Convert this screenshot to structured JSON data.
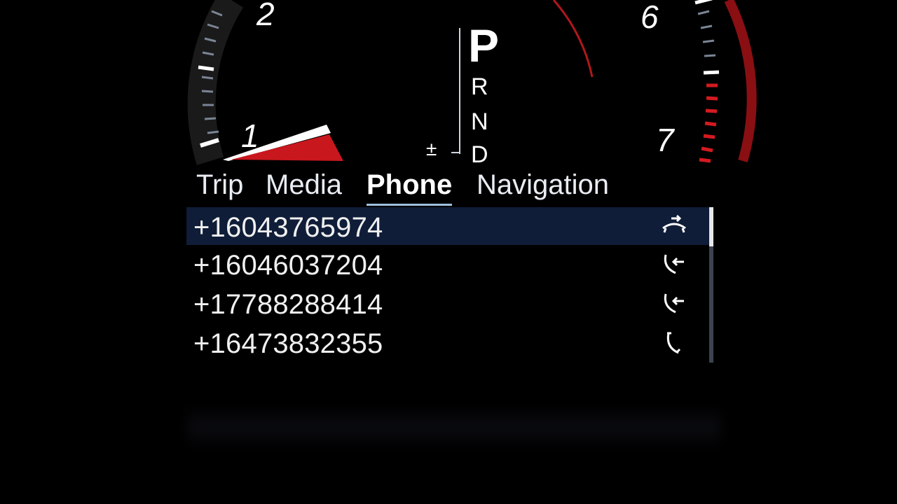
{
  "gauges": {
    "left_ticks": [
      "2",
      "1"
    ],
    "right_ticks": [
      "6",
      "7"
    ]
  },
  "gear_selector": {
    "current": "P",
    "options": [
      "R",
      "N",
      "D"
    ],
    "manual_label": "±"
  },
  "tabs": [
    {
      "label": "Trip",
      "active": false
    },
    {
      "label": "Media",
      "active": false
    },
    {
      "label": "Phone",
      "active": true
    },
    {
      "label": "Navigation",
      "active": false
    }
  ],
  "call_log": [
    {
      "number": "+16043765974",
      "icon": "outgoing-call-icon",
      "selected": true
    },
    {
      "number": "+16046037204",
      "icon": "incoming-call-icon",
      "selected": false
    },
    {
      "number": "+17788288414",
      "icon": "incoming-call-icon",
      "selected": false
    },
    {
      "number": "+16473832355",
      "icon": "phone-icon",
      "selected": false
    }
  ],
  "colors": {
    "accent_red": "#c8171d",
    "selection_bg": "#0f1d38",
    "tab_underline": "#9fc0de"
  }
}
